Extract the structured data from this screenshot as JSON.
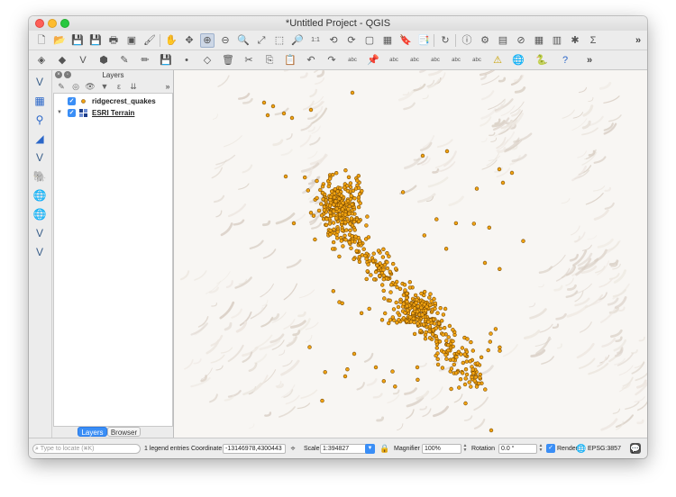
{
  "window": {
    "title": "*Untitled Project - QGIS"
  },
  "toolbar_row1": [
    {
      "name": "new-project-icon",
      "glyph": "🗋"
    },
    {
      "name": "open-project-icon",
      "glyph": "📂"
    },
    {
      "name": "save-project-icon",
      "glyph": "💾"
    },
    {
      "name": "save-as-icon",
      "glyph": "💾"
    },
    {
      "name": "print-layout-icon",
      "glyph": "🖶"
    },
    {
      "name": "layout-manager-icon",
      "glyph": "▣"
    },
    {
      "name": "style-manager-icon",
      "glyph": "🖌"
    },
    {
      "name": "pan-map-icon",
      "glyph": "✋"
    },
    {
      "name": "pan-to-selection-icon",
      "glyph": "✥"
    },
    {
      "name": "zoom-in-icon",
      "glyph": "⊕"
    },
    {
      "name": "zoom-out-icon",
      "glyph": "⊖"
    },
    {
      "name": "zoom-rubberband-icon",
      "glyph": "🔍"
    },
    {
      "name": "zoom-full-icon",
      "glyph": "⤢"
    },
    {
      "name": "zoom-to-selection-icon",
      "glyph": "⬚"
    },
    {
      "name": "zoom-to-layer-icon",
      "glyph": "🔎"
    },
    {
      "name": "zoom-native-icon",
      "glyph": "1:1"
    },
    {
      "name": "zoom-last-icon",
      "glyph": "⟲"
    },
    {
      "name": "zoom-next-icon",
      "glyph": "⟳"
    },
    {
      "name": "new-map-view-icon",
      "glyph": "▢"
    },
    {
      "name": "new-3d-map-icon",
      "glyph": "▦"
    },
    {
      "name": "bookmark-new-icon",
      "glyph": "🔖"
    },
    {
      "name": "bookmarks-icon",
      "glyph": "📑"
    },
    {
      "name": "refresh-icon",
      "glyph": "↻"
    },
    {
      "name": "identify-icon",
      "glyph": "ⓘ"
    },
    {
      "name": "select-features-icon",
      "glyph": "⚙"
    },
    {
      "name": "select-by-value-icon",
      "glyph": "▤"
    },
    {
      "name": "deselect-icon",
      "glyph": "⊘"
    },
    {
      "name": "open-attribute-table-icon",
      "glyph": "▦"
    },
    {
      "name": "field-calculator-icon",
      "glyph": "▥"
    },
    {
      "name": "processing-toolbox-icon",
      "glyph": "✱"
    },
    {
      "name": "statistics-sigma-icon",
      "glyph": "Σ"
    }
  ],
  "toolbar_row2": [
    {
      "name": "data-source-manager-icon",
      "glyph": "◈"
    },
    {
      "name": "new-geopackage-icon",
      "glyph": "◆"
    },
    {
      "name": "new-shapefile-icon",
      "glyph": "V"
    },
    {
      "name": "new-temp-layer-icon",
      "glyph": "⬢"
    },
    {
      "name": "current-edits-icon",
      "glyph": "✎"
    },
    {
      "name": "toggle-editing-icon",
      "glyph": "✏"
    },
    {
      "name": "save-edits-icon",
      "glyph": "💾"
    },
    {
      "name": "add-point-icon",
      "glyph": "•"
    },
    {
      "name": "vertex-tool-icon",
      "glyph": "◇"
    },
    {
      "name": "delete-selected-icon",
      "glyph": "🗑"
    },
    {
      "name": "cut-features-icon",
      "glyph": "✂"
    },
    {
      "name": "copy-features-icon",
      "glyph": "⎘"
    },
    {
      "name": "paste-features-icon",
      "glyph": "📋"
    },
    {
      "name": "undo-icon",
      "glyph": "↶"
    },
    {
      "name": "redo-icon",
      "glyph": "↷"
    },
    {
      "name": "label-tool-icon",
      "glyph": "abc"
    },
    {
      "name": "label-pin-icon",
      "glyph": "📌"
    },
    {
      "name": "label-show-hide-icon",
      "glyph": "abc"
    },
    {
      "name": "label-move-icon",
      "glyph": "abc"
    },
    {
      "name": "label-rotate-icon",
      "glyph": "abc"
    },
    {
      "name": "label-change-icon",
      "glyph": "abc"
    },
    {
      "name": "label-properties-icon",
      "glyph": "abc"
    },
    {
      "name": "warning-triangle-icon",
      "glyph": "⚠"
    },
    {
      "name": "globe-plugin-icon",
      "glyph": "🌐"
    },
    {
      "name": "python-console-icon",
      "glyph": "🐍"
    },
    {
      "name": "help-icon",
      "glyph": "?"
    }
  ],
  "left_tools": [
    {
      "name": "add-vector-layer-icon",
      "glyph": "V"
    },
    {
      "name": "add-raster-layer-icon",
      "glyph": "▦"
    },
    {
      "name": "add-spatialite-layer-icon",
      "glyph": "⚲"
    },
    {
      "name": "add-mesh-layer-icon",
      "glyph": "◢"
    },
    {
      "name": "add-vector-tile-icon",
      "glyph": "V"
    },
    {
      "name": "add-postgis-layer-icon",
      "glyph": "🐘"
    },
    {
      "name": "add-wms-layer-icon",
      "glyph": "🌐"
    },
    {
      "name": "add-wcs-layer-icon",
      "glyph": "🌐"
    },
    {
      "name": "add-wfs-layer-icon",
      "glyph": "V"
    },
    {
      "name": "add-delimited-text-icon",
      "glyph": "V"
    }
  ],
  "layers_panel": {
    "title": "Layers",
    "tools": [
      {
        "name": "open-layer-styling-icon",
        "glyph": "✎"
      },
      {
        "name": "add-group-icon",
        "glyph": "◎"
      },
      {
        "name": "manage-map-themes-icon",
        "glyph": "👁"
      },
      {
        "name": "filter-legend-icon",
        "glyph": "▼"
      },
      {
        "name": "filter-expression-icon",
        "glyph": "ε"
      },
      {
        "name": "expand-all-icon",
        "glyph": "⇊"
      }
    ],
    "layers": [
      {
        "name": "ridgecrest_quakes",
        "checked": true,
        "icon": "point-symbol-icon"
      },
      {
        "name": "ESRI Terrain",
        "checked": true,
        "icon": "raster-tile-icon"
      }
    ],
    "tabs": [
      "Layers",
      "Browser"
    ],
    "active_tab": "Layers"
  },
  "map": {
    "point_color": "#f2a412",
    "point_outline": "#7a4a00",
    "terrain_colors": [
      "#f8f6f3",
      "#ece6df",
      "#d9cfc5"
    ]
  },
  "statusbar": {
    "locate_placeholder": "Type to locate (⌘K)",
    "legend_entries": "1 legend entries",
    "coordinate_label": "Coordinate",
    "coordinate_value": "-13146978,4300443",
    "scale_label": "Scale",
    "scale_value": "1:394827",
    "magnifier_label": "Magnifier",
    "magnifier_value": "100%",
    "rotation_label": "Rotation",
    "rotation_value": "0.0 °",
    "render_label": "Render",
    "render_checked": true,
    "crs": "EPSG:3857"
  }
}
